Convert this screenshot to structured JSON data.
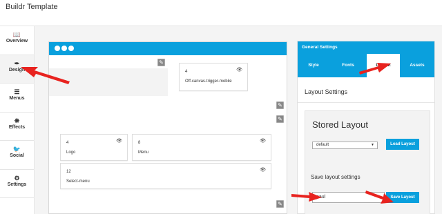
{
  "app": {
    "title": "Buildr Template"
  },
  "sidebar": {
    "items": [
      {
        "label": "Overview",
        "icon": "book-icon"
      },
      {
        "label": "Design",
        "icon": "brush-icon"
      },
      {
        "label": "Menus",
        "icon": "menu-icon"
      },
      {
        "label": "Effects",
        "icon": "effects-icon"
      },
      {
        "label": "Social",
        "icon": "twitter-icon"
      },
      {
        "label": "Settings",
        "icon": "gear-icon"
      }
    ]
  },
  "canvas": {
    "modules": [
      {
        "num": "4",
        "name": "Off-canvas-trigger-mobile"
      },
      {
        "num": "4",
        "name": "Logo"
      },
      {
        "num": "8",
        "name": "Menu"
      },
      {
        "num": "12",
        "name": "Select-menu"
      }
    ]
  },
  "settings": {
    "header": "General Settings",
    "tabs": [
      "Style",
      "Fonts",
      "Layout",
      "Assets"
    ],
    "active_tab": "Layout",
    "section_title": "Layout Settings",
    "stored_layout_title": "Stored Layout",
    "selected_layout": "default",
    "load_button": "Load Layout",
    "save_label": "Save layout settings",
    "input_value": "paul",
    "save_button": "Save Layout"
  },
  "colors": {
    "accent": "#0aa0dd",
    "arrow": "#e8231f"
  }
}
